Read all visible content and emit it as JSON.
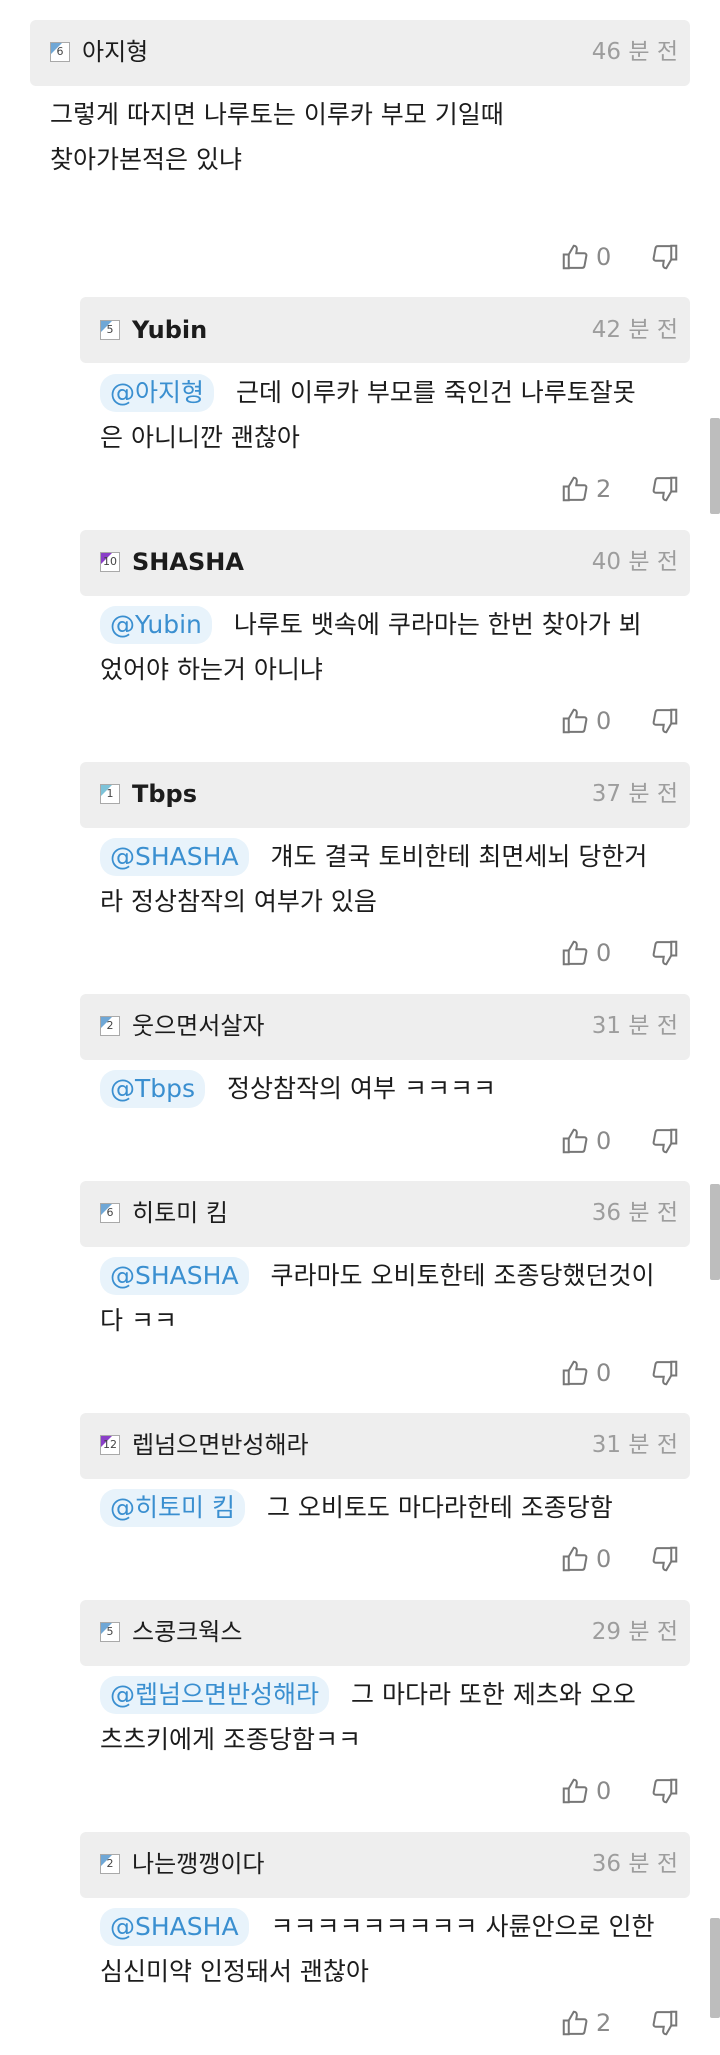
{
  "comments": [
    {
      "level": "6",
      "nick": "아지형",
      "time": "46 분 전",
      "mention": "",
      "text_lines": [
        "그렇게 따지면 나루토는 이루카 부모 기일때",
        "찾아가본적은 있냐"
      ],
      "up": "0"
    },
    {
      "level": "5",
      "nick": "Yubin",
      "time": "42 분 전",
      "mention": "@아지형",
      "text_lines": [
        "근데 이루카 부모를 죽인건 나루토잘못",
        "은 아니니깐 괜찮아"
      ],
      "up": "2"
    },
    {
      "level": "10",
      "nick": "SHASHA",
      "time": "40 분 전",
      "mention": "@Yubin",
      "text_lines": [
        "나루토 뱃속에 쿠라마는 한번 찾아가 뵈",
        "었어야 하는거 아니냐"
      ],
      "up": "0"
    },
    {
      "level": "1",
      "nick": "Tbps",
      "time": "37 분 전",
      "mention": "@SHASHA",
      "text_lines": [
        "걔도 결국 토비한테 최면세뇌 당한거",
        "라 정상참작의 여부가 있음"
      ],
      "up": "0"
    },
    {
      "level": "2",
      "nick": "웃으면서살자",
      "time": "31 분 전",
      "mention": "@Tbps",
      "text_lines": [
        "정상참작의 여부 ㅋㅋㅋㅋ"
      ],
      "up": "0"
    },
    {
      "level": "6",
      "nick": "히토미 킴",
      "time": "36 분 전",
      "mention": "@SHASHA",
      "text_lines": [
        "쿠라마도 오비토한테 조종당했던것이",
        "다 ㅋㅋ"
      ],
      "up": "0"
    },
    {
      "level": "12",
      "nick": "렙넘으면반성해라",
      "time": "31 분 전",
      "mention": "@히토미 킴",
      "text_lines": [
        "그 오비토도 마다라한테 조종당함"
      ],
      "up": "0"
    },
    {
      "level": "5",
      "nick": "스콩크웍스",
      "time": "29 분 전",
      "mention": "@렙넘으면반성해라",
      "text_lines": [
        "그 마다라 또한 제츠와 오오",
        "츠츠키에게 조종당함ㅋㅋ"
      ],
      "up": "0"
    },
    {
      "level": "2",
      "nick": "나는깽깽이다",
      "time": "36 분 전",
      "mention": "@SHASHA",
      "text_lines": [
        "ㅋㅋㅋㅋㅋㅋㅋㅋㅋ 사륜안으로 인한",
        "심신미약 인정돼서 괜찮아"
      ],
      "up": "2"
    }
  ],
  "icons": {
    "upvote": "thumbs-up-outline-icon",
    "downvote": "thumbs-down-outline-icon",
    "level_badge": "level-badge-icon"
  },
  "colors": {
    "mention_text": "#3a8fd0",
    "mention_bg": "#e8f3fb",
    "header_bg": "#eeeeee",
    "time": "#9d9d9d"
  }
}
